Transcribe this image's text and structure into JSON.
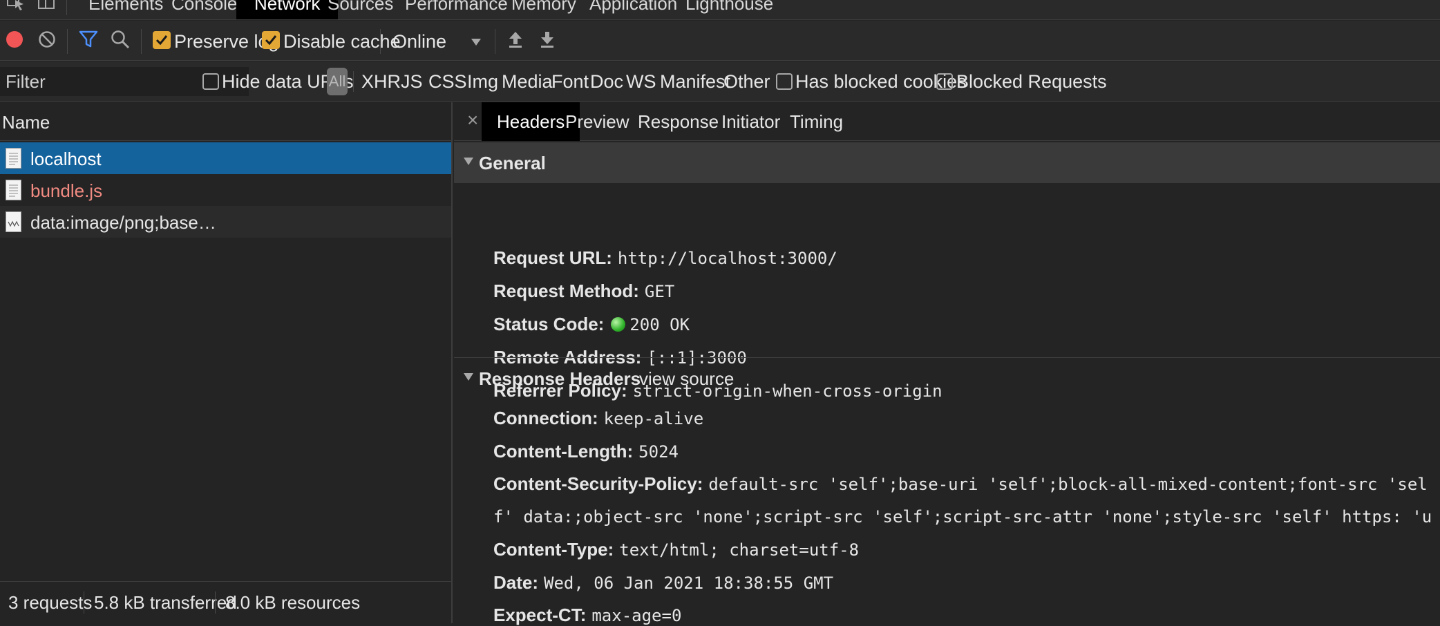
{
  "top_tabs": [
    "Elements",
    "Console",
    "Network",
    "Sources",
    "Performance",
    "Memory",
    "Application",
    "Lighthouse"
  ],
  "active_top_tab": "Network",
  "toolbar": {
    "preserve_log": "Preserve log",
    "disable_cache": "Disable cache",
    "throttling": "Online",
    "preserve_log_checked": true,
    "disable_cache_checked": true
  },
  "filter": {
    "placeholder": "Filter",
    "hide_data_urls": "Hide data URLs",
    "types": [
      "All",
      "XHR",
      "JS",
      "CSS",
      "Img",
      "Media",
      "Font",
      "Doc",
      "WS",
      "Manifest",
      "Other"
    ],
    "has_blocked_cookies": "Has blocked cookies",
    "blocked_requests": "Blocked Requests"
  },
  "requests": {
    "header": "Name",
    "items": [
      {
        "name": "localhost",
        "selected": true
      },
      {
        "name": "bundle.js",
        "color": "#f28b82"
      },
      {
        "name": "data:image/png;base…"
      }
    ]
  },
  "summary": {
    "requests": "3 requests",
    "transferred": "5.8 kB transferred",
    "resources": "8.0 kB resources"
  },
  "detail_tabs": [
    "Headers",
    "Preview",
    "Response",
    "Initiator",
    "Timing"
  ],
  "active_detail_tab": "Headers",
  "general": {
    "title": "General",
    "rows": [
      {
        "key": "Request URL:",
        "value": "http://localhost:3000/"
      },
      {
        "key": "Request Method:",
        "value": "GET"
      },
      {
        "key": "Status Code:",
        "value": "200 OK"
      },
      {
        "key": "Remote Address:",
        "value": "[::1]:3000"
      },
      {
        "key": "Referrer Policy:",
        "value": "strict-origin-when-cross-origin"
      }
    ]
  },
  "response_headers": {
    "title": "Response Headers",
    "view_source": "view source",
    "rows": [
      {
        "key": "Connection:",
        "value": "keep-alive"
      },
      {
        "key": "Content-Length:",
        "value": "5024"
      },
      {
        "key": "Content-Security-Policy:",
        "value": "default-src 'self';base-uri 'self';block-all-mixed-content;font-src 'sel"
      },
      {
        "key": "Content-Type:",
        "value": "text/html; charset=utf-8"
      },
      {
        "key": "Date:",
        "value": "Wed, 06 Jan 2021 18:38:55 GMT"
      },
      {
        "key": "Expect-CT:",
        "value": "max-age=0"
      }
    ],
    "csp_continuation": "f' data:;object-src 'none';script-src 'self';script-src-attr 'none';style-src 'self' https: 'u"
  },
  "colors": {
    "record": "#f25555",
    "filter_icon": "#4d90fe",
    "checkbox": "#e3a736",
    "selected_row": "#15639d",
    "status_ok": "#2fb12a"
  }
}
